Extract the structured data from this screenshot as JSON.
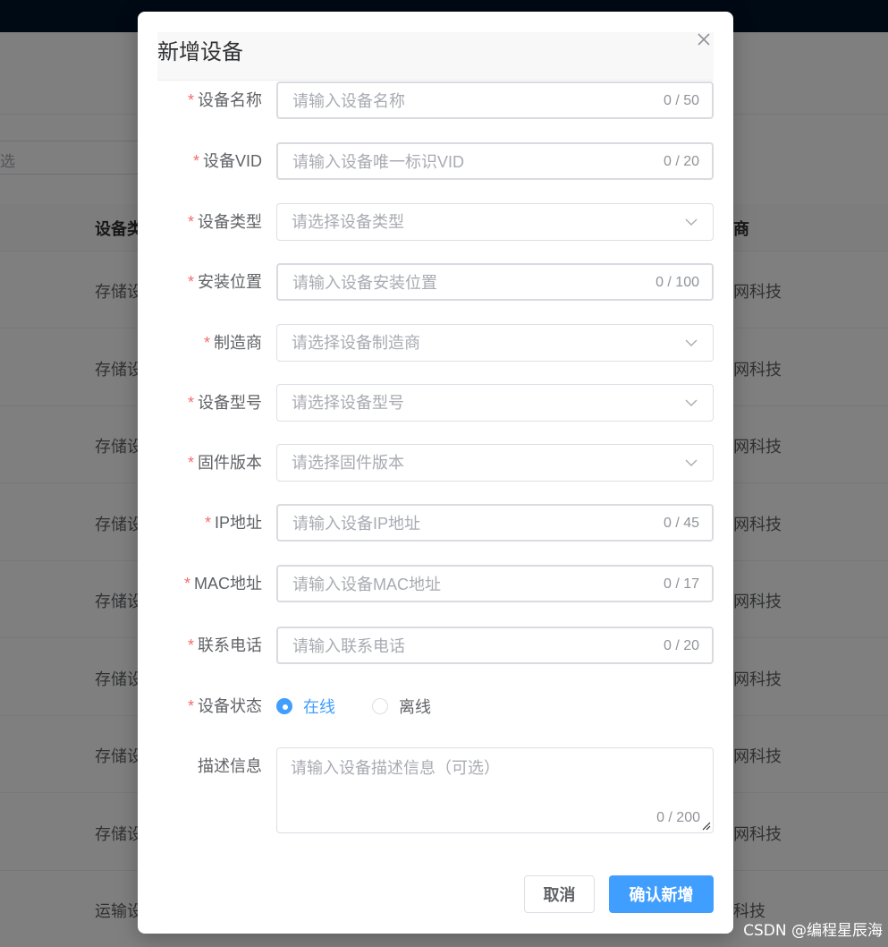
{
  "background": {
    "search_placeholder_fragment": "选",
    "headers": {
      "device_type_fragment": "设备类",
      "manufacturer_fragment": "商"
    },
    "rows": [
      {
        "type_fragment": "存储设",
        "maker_fragment": "网科技"
      },
      {
        "type_fragment": "存储设",
        "maker_fragment": "网科技"
      },
      {
        "type_fragment": "存储设",
        "maker_fragment": "网科技"
      },
      {
        "type_fragment": "存储设",
        "maker_fragment": "网科技"
      },
      {
        "type_fragment": "存储设",
        "maker_fragment": "网科技"
      },
      {
        "type_fragment": "存储设",
        "maker_fragment": "网科技"
      },
      {
        "type_fragment": "存储设",
        "maker_fragment": "网科技"
      },
      {
        "type_fragment": "存储设",
        "maker_fragment": "网科技"
      },
      {
        "type_fragment": "运输设",
        "maker_fragment": "科技"
      }
    ]
  },
  "watermark": "CSDN @编程星辰海",
  "dialog": {
    "title": "新增设备",
    "close_icon": "close-icon",
    "fields": {
      "device_name": {
        "label": "设备名称",
        "required": "*",
        "placeholder": "请输入设备名称",
        "count": "0 / 50"
      },
      "device_vid": {
        "label": "设备VID",
        "required": "*",
        "placeholder": "请输入设备唯一标识VID",
        "count": "0 / 20"
      },
      "device_type": {
        "label": "设备类型",
        "required": "*",
        "placeholder": "请选择设备类型",
        "icon": "chevron-down-icon"
      },
      "install_location": {
        "label": "安装位置",
        "required": "*",
        "placeholder": "请输入设备安装位置",
        "count": "0 / 100"
      },
      "manufacturer": {
        "label": "制造商",
        "required": "*",
        "placeholder": "请选择设备制造商",
        "icon": "chevron-down-icon"
      },
      "device_model": {
        "label": "设备型号",
        "required": "*",
        "placeholder": "请选择设备型号",
        "icon": "chevron-down-icon"
      },
      "firmware_version": {
        "label": "固件版本",
        "required": "*",
        "placeholder": "请选择固件版本",
        "icon": "chevron-down-icon"
      },
      "ip_address": {
        "label": "IP地址",
        "required": "*",
        "placeholder": "请输入设备IP地址",
        "count": "0 / 45"
      },
      "mac_address": {
        "label": "MAC地址",
        "required": "*",
        "placeholder": "请输入设备MAC地址",
        "count": "0 / 17"
      },
      "contact_phone": {
        "label": "联系电话",
        "required": "*",
        "placeholder": "请输入联系电话",
        "count": "0 / 20"
      },
      "device_status": {
        "label": "设备状态",
        "required": "*",
        "options": [
          "在线",
          "离线"
        ],
        "selected": "在线"
      },
      "description": {
        "label": "描述信息",
        "placeholder": "请输入设备描述信息（可选）",
        "count": "0 / 200"
      }
    },
    "buttons": {
      "cancel": "取消",
      "confirm": "确认新增"
    },
    "colors": {
      "primary": "#409eff",
      "required": "#f56c6c",
      "placeholder": "#a8abb2"
    }
  }
}
